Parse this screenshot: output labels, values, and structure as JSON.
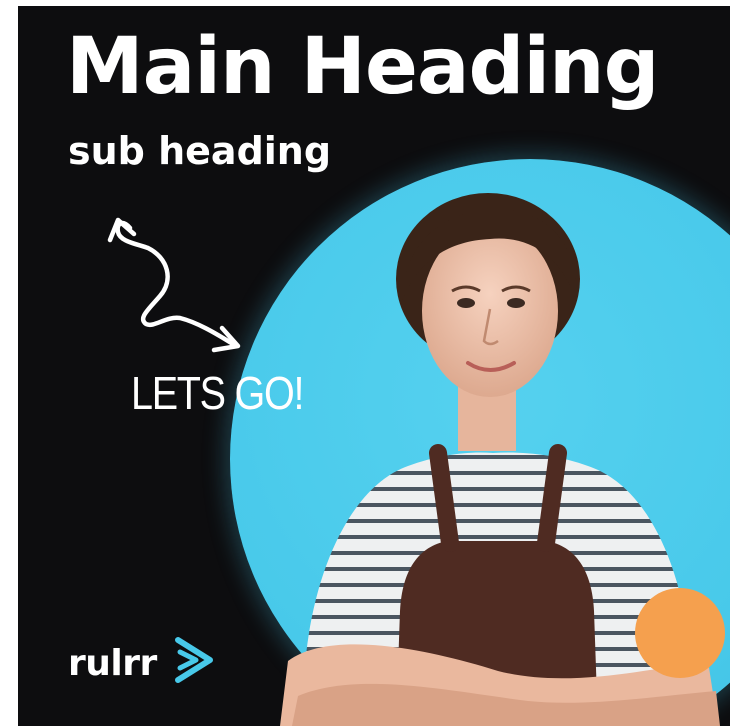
{
  "banner": {
    "heading": "Main Heading",
    "subheading": "sub heading",
    "cta_part_1": "LETS ",
    "cta_part_2": "GO!",
    "brand": "rulrr"
  },
  "colors": {
    "background": "#0d0d0f",
    "accent_blue": "#48c9ea",
    "accent_orange": "#f5a04e",
    "text": "#ffffff"
  },
  "icons": {
    "doodle": "curly-arrow-icon",
    "logo": "chevron-play-icon"
  }
}
